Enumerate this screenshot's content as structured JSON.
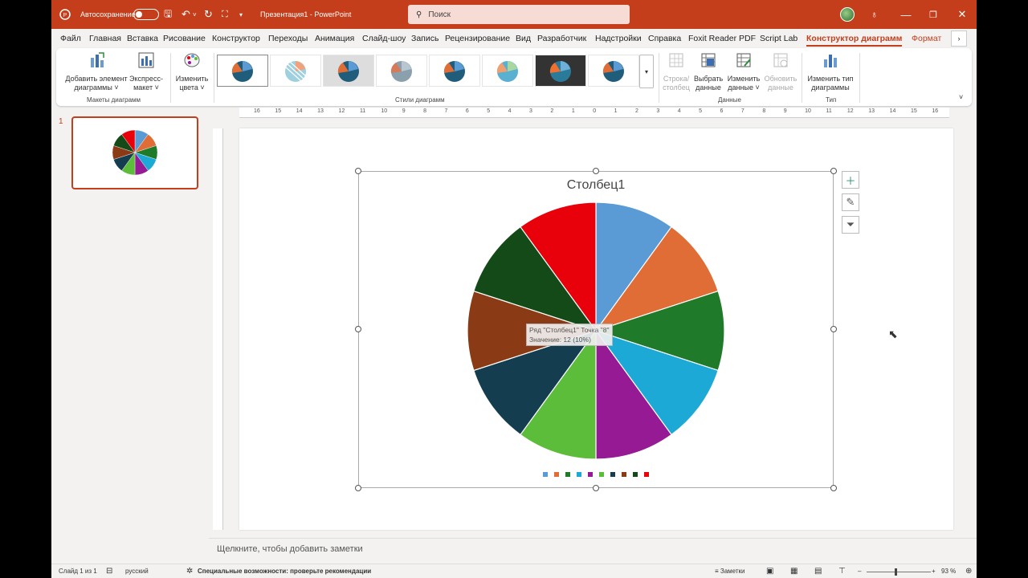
{
  "titlebar": {
    "autosave_label": "Автосохранение",
    "document_title": "Презентация1  -  PowerPoint",
    "search_placeholder": "Поиск"
  },
  "tabs": [
    {
      "label": "Файл"
    },
    {
      "label": "Главная"
    },
    {
      "label": "Вставка"
    },
    {
      "label": "Рисование"
    },
    {
      "label": "Конструктор"
    },
    {
      "label": "Переходы"
    },
    {
      "label": "Анимация"
    },
    {
      "label": "Слайд-шоу"
    },
    {
      "label": "Запись"
    },
    {
      "label": "Рецензирование"
    },
    {
      "label": "Вид"
    },
    {
      "label": "Разработчик"
    },
    {
      "label": "Надстройки"
    },
    {
      "label": "Справка"
    },
    {
      "label": "Foxit Reader PDF"
    },
    {
      "label": "Script Lab"
    },
    {
      "label": "Конструктор диаграмм"
    },
    {
      "label": "Формат"
    }
  ],
  "ribbon": {
    "add_element": [
      "Добавить элемент",
      "диаграммы ˅"
    ],
    "express_layout": [
      "Экспресс-",
      "макет ˅"
    ],
    "change_colors": [
      "Изменить",
      "цвета ˅"
    ],
    "row_column": [
      "Строка/",
      "столбец"
    ],
    "select_data": [
      "Выбрать",
      "данные"
    ],
    "edit_data": [
      "Изменить",
      "данные ˅"
    ],
    "refresh_data": [
      "Обновить",
      "данные"
    ],
    "change_type": [
      "Изменить тип",
      "диаграммы"
    ],
    "group_layouts": "Макеты диаграмм",
    "group_styles": "Стили диаграмм",
    "group_data": "Данные",
    "group_type": "Тип"
  },
  "slides": {
    "current_number": "1"
  },
  "ruler_labels": [
    "16",
    "15",
    "14",
    "13",
    "12",
    "11",
    "10",
    "9",
    "8",
    "7",
    "6",
    "5",
    "4",
    "3",
    "2",
    "1",
    "0",
    "1",
    "2",
    "3",
    "4",
    "5",
    "6",
    "7",
    "8",
    "9",
    "10",
    "11",
    "12",
    "13",
    "14",
    "15",
    "16"
  ],
  "chart_data": {
    "type": "pie",
    "title": "Столбец1",
    "categories": [
      "",
      "",
      "",
      "",
      "",
      "",
      "",
      "",
      "",
      ""
    ],
    "values": [
      12,
      12,
      12,
      12,
      12,
      12,
      12,
      12,
      12,
      12
    ],
    "colors": [
      "#5b9bd5",
      "#e06d35",
      "#1f7a2a",
      "#1ca9d6",
      "#951a93",
      "#5bbd3a",
      "#143e4f",
      "#8b3a16",
      "#134a18",
      "#e8000b"
    ],
    "legend": "bottom",
    "tooltip_lines": [
      "Ряд \"Столбец1\" Точка \"8\"",
      "Значение: 12 (10%)"
    ]
  },
  "notes_placeholder": "Щелкните, чтобы добавить заметки",
  "status": {
    "slide_info": "Слайд 1 из 1",
    "language": "русский",
    "accessibility": "Специальные возможности: проверьте рекомендации",
    "notes_button": "Заметки",
    "zoom": "93 %"
  }
}
